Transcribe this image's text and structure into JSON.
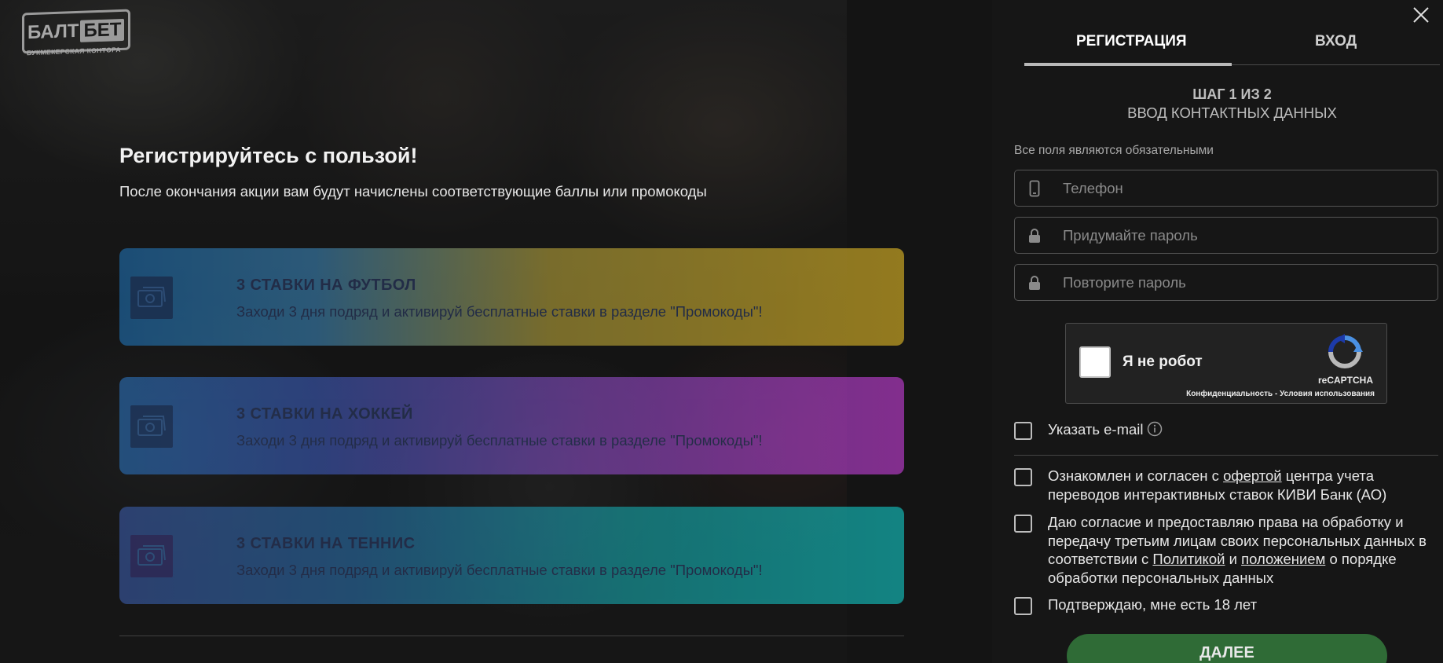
{
  "logo": {
    "balt": "БАЛТ",
    "bet": "БЕТ",
    "sub": "букмекерская контора"
  },
  "promo": {
    "title": "Регистрируйтесь с пользой!",
    "subtitle": "После окончания акции вам будут начислены соответствующие баллы или промокоды",
    "cards": [
      {
        "title": "3 СТАВКИ НА ФУТБОЛ",
        "text": "Заходи 3 дня подряд и активируй бесплатные ставки в разделе \"Промокоды\"!",
        "icon": "ticket-icon"
      },
      {
        "title": "3 СТАВКИ НА ХОККЕЙ",
        "text": "Заходи 3 дня подряд и активируй бесплатные ставки в разделе \"Промокоды\"!",
        "icon": "ticket-icon"
      },
      {
        "title": "3 СТАВКИ НА ТЕННИС",
        "text": "Заходи 3 дня подряд и активируй бесплатные ставки в разделе \"Промокоды\"!",
        "icon": "ticket-icon"
      }
    ]
  },
  "panel": {
    "tabs": {
      "register": "РЕГИСТРАЦИЯ",
      "login": "ВХОД",
      "active": "register"
    },
    "step": {
      "title": "ШАГ 1 ИЗ 2",
      "subtitle": "ВВОД КОНТАКТНЫХ ДАННЫХ"
    },
    "required_note": "Все поля являются обязательными",
    "fields": {
      "phone": {
        "placeholder": "Телефон",
        "value": "",
        "icon": "phone-icon"
      },
      "password": {
        "placeholder": "Придумайте пароль",
        "value": "",
        "icon": "lock-icon"
      },
      "password_repeat": {
        "placeholder": "Повторите пароль",
        "value": "",
        "icon": "lock-icon"
      }
    },
    "recaptcha": {
      "label": "Я не робот",
      "brand": "reCAPTCHA",
      "privacy": "Конфиденциальность",
      "separator": " - ",
      "terms": "Условия использования"
    },
    "checks": {
      "email": {
        "label": "Указать e-mail",
        "checked": false
      },
      "offer": {
        "before": "Ознакомлен и согласен с ",
        "link": "офертой",
        "after": " центра учета переводов интерактивных ставок КИВИ Банк (АО)",
        "checked": false
      },
      "consent": {
        "before": "Даю согласие и предоставляю права на обработку и передачу третьим лицам своих персональных данных в соответствии с ",
        "link1": "Политикой",
        "middle": " и ",
        "link2": "положением",
        "after": " о порядке обработки персональных данных",
        "checked": false
      },
      "age": {
        "label": "Подтверждаю, мне есть 18 лет",
        "checked": false
      }
    },
    "next_button": "ДАЛЕЕ"
  },
  "colors": {
    "panel_bg": "#161616",
    "next_button": "#2f6b36",
    "card_football": "#e1b825",
    "card_hockey": "#c63ed8",
    "card_tennis": "#12c8c6"
  }
}
